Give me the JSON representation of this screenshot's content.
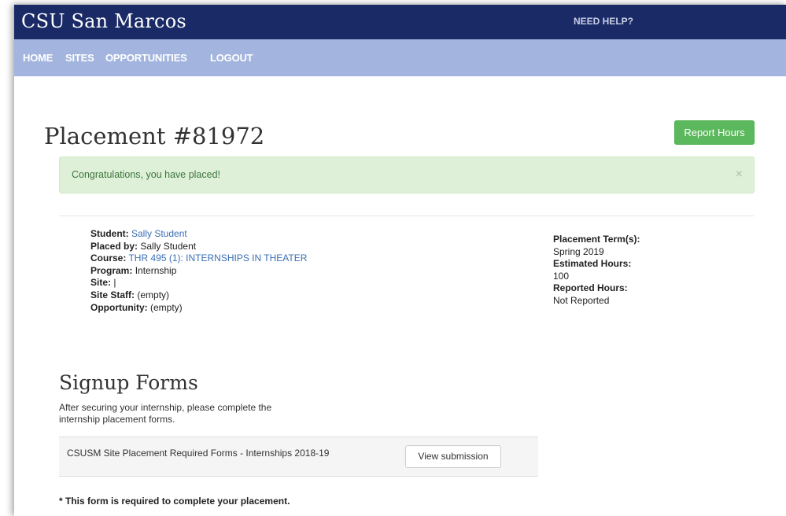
{
  "header": {
    "brand": "CSU San Marcos",
    "need_help": "NEED HELP?"
  },
  "nav": {
    "items": [
      "HOME",
      "SITES",
      "OPPORTUNITIES",
      "LOGOUT"
    ]
  },
  "page": {
    "title": "Placement #81972",
    "report_hours": "Report Hours"
  },
  "alert": {
    "message": "Congratulations, you have placed!",
    "close": "×"
  },
  "details": {
    "student_label": "Student:",
    "student_value": "Sally Student",
    "placed_by_label": "Placed by:",
    "placed_by_value": "Sally Student",
    "course_label": "Course:",
    "course_value": "THR 495 (1): INTERNSHIPS IN THEATER",
    "program_label": "Program:",
    "program_value": "Internship",
    "site_label": "Site:",
    "site_value": "|",
    "site_staff_label": "Site Staff:",
    "site_staff_value": "(empty)",
    "opportunity_label": "Opportunity:",
    "opportunity_value": "(empty)"
  },
  "summary": {
    "term_label": "Placement Term(s):",
    "term_value": "Spring 2019",
    "estimated_label": "Estimated Hours:",
    "estimated_value": "100",
    "reported_label": "Reported Hours:",
    "reported_value": "Not Reported"
  },
  "signup": {
    "title": "Signup Forms",
    "description": "After securing your internship, please complete the internship placement forms.",
    "form_name": "CSUSM Site Placement Required Forms - Internships 2018-19",
    "view_button": "View submission",
    "required_note": "* This form is required to complete your placement."
  }
}
